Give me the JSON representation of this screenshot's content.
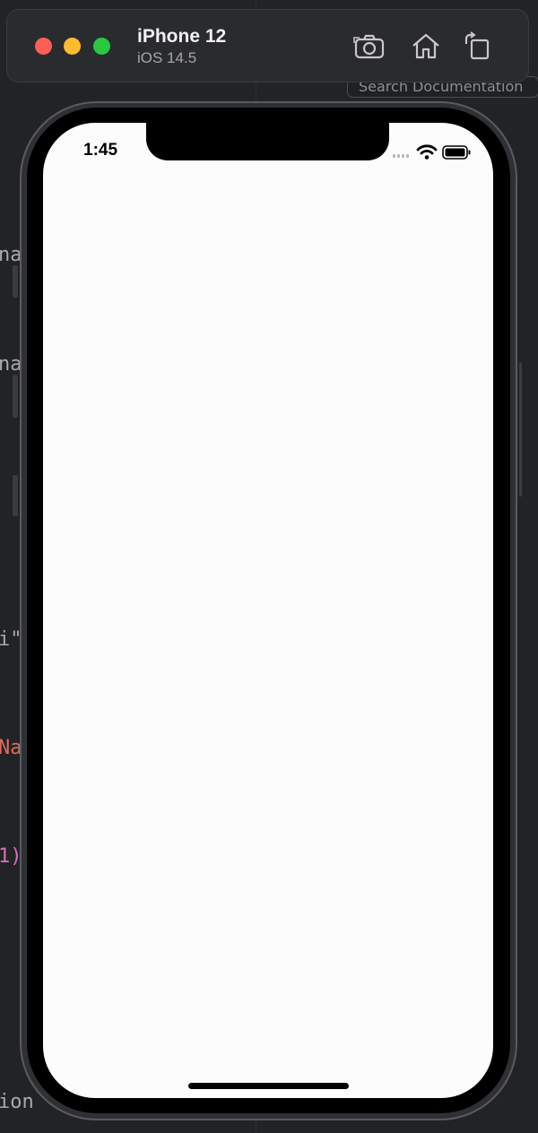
{
  "simulator": {
    "device_name": "iPhone 12",
    "os_version": "iOS 14.5",
    "buttons": [
      "screenshot-button",
      "home-button",
      "rotate-button"
    ],
    "traffic_lights": {
      "close": "#ff5f57",
      "minimize": "#febc2e",
      "zoom": "#28c840"
    }
  },
  "background_editor": {
    "search_placeholder": "Search Documentation",
    "code_fragments": [
      {
        "text": "na",
        "color": "#a9a9ad"
      },
      {
        "text": "na",
        "color": "#a9a9ad"
      },
      {
        "text": "i\"",
        "color": "#a9a9ad"
      },
      {
        "text": "Na",
        "color": "#e06c5a"
      },
      {
        "text": "1)",
        "color": "#d96fb3"
      },
      {
        "text": "ion",
        "color": "#a9a9ad"
      }
    ]
  },
  "status_bar": {
    "time": "1:45",
    "icons": [
      "cellular-icon",
      "wifi-icon",
      "battery-icon"
    ]
  },
  "app_screen": {
    "background": "#fdfcfd",
    "content": ""
  }
}
